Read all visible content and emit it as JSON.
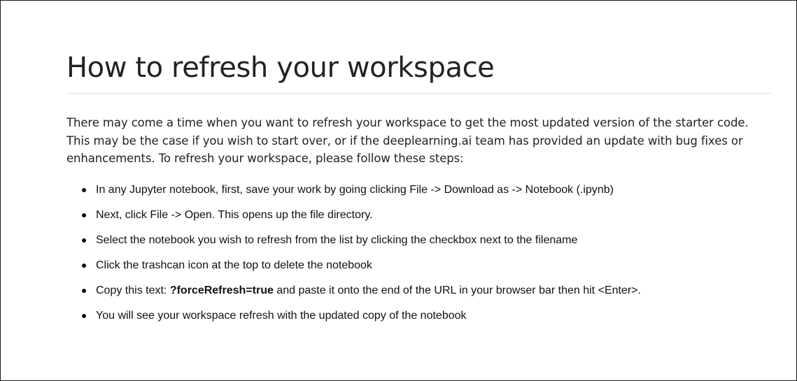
{
  "page": {
    "title": "How to refresh your workspace",
    "intro": "There may come a time when you want to refresh your workspace to get the most updated version of the starter code.  This may be the case if you wish to start over, or if the deeplearning.ai team has provided an update with bug fixes or enhancements.  To refresh your workspace, please follow these steps:",
    "steps": [
      {
        "text": "In any Jupyter notebook, first, save your work by going clicking File -> Download as -> Notebook (.ipynb)"
      },
      {
        "text": "Next, click File -> Open. This opens up the file directory."
      },
      {
        "text": "Select the notebook you wish to refresh from the list by clicking the checkbox next to the filename"
      },
      {
        "text": "Click the trashcan icon at the top to delete the notebook"
      },
      {
        "before": "Copy this text: ",
        "strong": "?forceRefresh=true",
        "after": " and paste it onto the end of the URL in your browser bar then hit <Enter>."
      },
      {
        "text": "You will see your workspace refresh with the updated copy of the notebook"
      }
    ]
  }
}
